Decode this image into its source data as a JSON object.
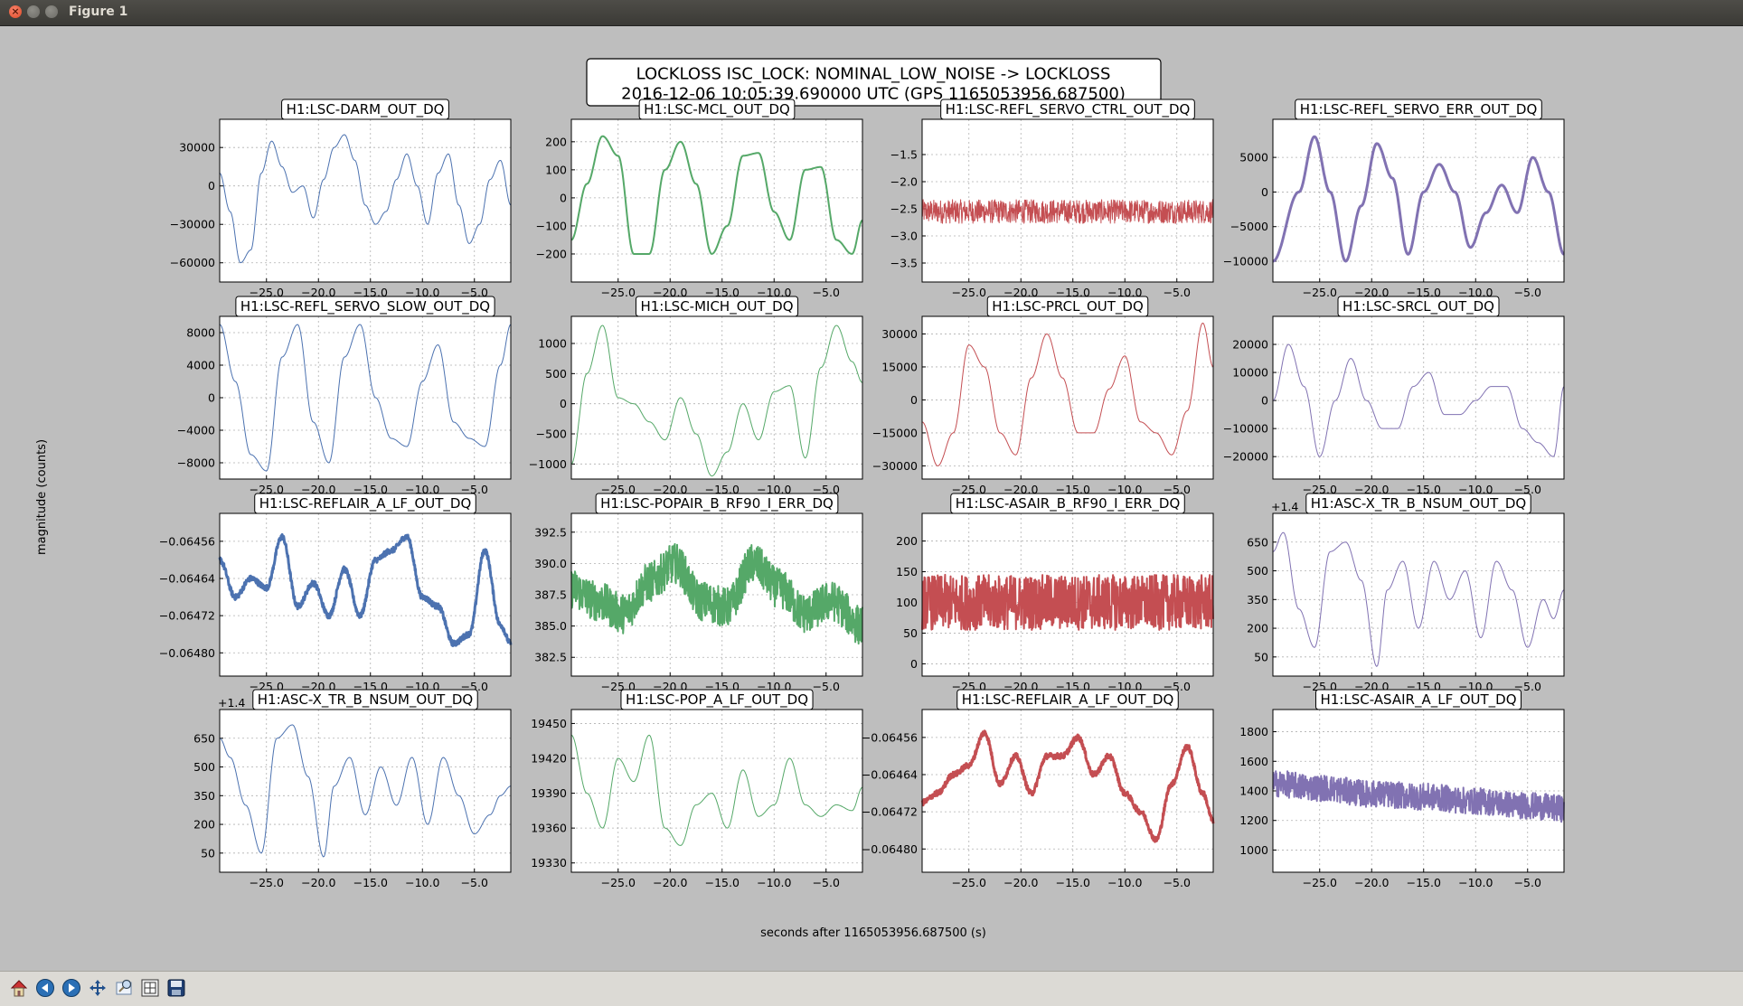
{
  "window": {
    "title": "Figure 1"
  },
  "figure": {
    "title_line1": "LOCKLOSS ISC_LOCK: NOMINAL_LOW_NOISE -> LOCKLOSS",
    "title_line2": "2016-12-06 10:05:39.690000 UTC (GPS 1165053956.687500)",
    "xlabel": "seconds after 1165053956.687500 (s)",
    "ylabel": "magnitude (counts)"
  },
  "colors": {
    "blue": "#4c72b0",
    "green": "#55a868",
    "red": "#c44e52",
    "purple": "#8172b2"
  },
  "toolbar": {
    "icons": [
      "home-icon",
      "back-icon",
      "forward-icon",
      "pan-icon",
      "zoom-icon",
      "subplots-icon",
      "save-icon"
    ]
  },
  "chart_data": [
    {
      "type": "line",
      "title": "H1:LSC-DARM_OUT_DQ",
      "color": "blue",
      "lw": 1,
      "noise": 0,
      "xlim": [
        -29.5,
        -1.5
      ],
      "ylim": [
        -75000,
        52000
      ],
      "xticks": [
        -25,
        -20,
        -15,
        -10,
        -5
      ],
      "yticks": [
        30000,
        0,
        -30000,
        -60000
      ],
      "ytick_labels": [
        "30000",
        "0",
        "−30000",
        "−60000"
      ],
      "x": [
        -29.5,
        -28.5,
        -27.5,
        -26.5,
        -25.5,
        -24.5,
        -23.5,
        -22.5,
        -21.5,
        -20.5,
        -19.5,
        -18.5,
        -17.5,
        -16.5,
        -15.5,
        -14.5,
        -13.5,
        -12.5,
        -11.5,
        -10.5,
        -9.5,
        -8.5,
        -7.5,
        -6.5,
        -5.5,
        -4.5,
        -3.5,
        -2.5,
        -1.5
      ],
      "y": [
        10000,
        -20000,
        -60000,
        -50000,
        10000,
        35000,
        15000,
        -5000,
        0,
        -25000,
        5000,
        30000,
        40000,
        20000,
        -15000,
        -30000,
        -20000,
        5000,
        25000,
        0,
        -30000,
        10000,
        25000,
        -15000,
        -45000,
        -30000,
        5000,
        20000,
        -15000
      ]
    },
    {
      "type": "line",
      "title": "H1:LSC-MCL_OUT_DQ",
      "color": "green",
      "lw": 2,
      "noise": 0,
      "xlim": [
        -29.5,
        -1.5
      ],
      "ylim": [
        -300,
        280
      ],
      "xticks": [
        -25,
        -20,
        -15,
        -10,
        -5
      ],
      "yticks": [
        200,
        100,
        0,
        -100,
        -200
      ],
      "ytick_labels": [
        "200",
        "100",
        "0",
        "−100",
        "−200"
      ],
      "x": [
        -29.5,
        -28,
        -26.5,
        -25,
        -23.5,
        -22,
        -20.5,
        -19,
        -17.5,
        -16,
        -14.5,
        -13,
        -11.5,
        -10,
        -8.5,
        -7,
        -5.5,
        -4,
        -2.5,
        -1.5
      ],
      "y": [
        -150,
        50,
        220,
        150,
        -200,
        -200,
        100,
        200,
        50,
        -200,
        -100,
        150,
        160,
        -50,
        -150,
        100,
        110,
        -150,
        -200,
        -80
      ]
    },
    {
      "type": "line",
      "title": "H1:LSC-REFL_SERVO_CTRL_OUT_DQ",
      "color": "red",
      "lw": 1,
      "noise": 0.22,
      "xlim": [
        -29.5,
        -1.5
      ],
      "ylim": [
        -3.85,
        -0.85
      ],
      "xticks": [
        -25,
        -20,
        -15,
        -10,
        -5
      ],
      "yticks": [
        -1.5,
        -2.0,
        -2.5,
        -3.0,
        -3.5
      ],
      "ytick_labels": [
        "−1.5",
        "−2.0",
        "−2.5",
        "−3.0",
        "−3.5"
      ],
      "x": [
        -29.5,
        -1.5
      ],
      "y": [
        -2.55,
        -2.55
      ]
    },
    {
      "type": "line",
      "title": "H1:LSC-REFL_SERVO_ERR_OUT_DQ",
      "color": "purple",
      "lw": 3,
      "noise": 0,
      "xlim": [
        -29.5,
        -1.5
      ],
      "ylim": [
        -13000,
        10500
      ],
      "xticks": [
        -25,
        -20,
        -15,
        -10,
        -5
      ],
      "yticks": [
        5000,
        0,
        -5000,
        -10000
      ],
      "ytick_labels": [
        "5000",
        "0",
        "−5000",
        "−10000"
      ],
      "x": [
        -29.5,
        -27,
        -25.5,
        -24,
        -22.5,
        -21,
        -19.5,
        -18,
        -16.5,
        -15,
        -13.5,
        -12,
        -10.5,
        -9,
        -7.5,
        -6,
        -4.5,
        -3,
        -1.5
      ],
      "y": [
        -10000,
        0,
        8000,
        0,
        -10000,
        -2000,
        7000,
        2000,
        -9000,
        0,
        4000,
        0,
        -8000,
        -3000,
        1000,
        -3000,
        5000,
        0,
        -9000
      ]
    },
    {
      "type": "line",
      "title": "H1:LSC-REFL_SERVO_SLOW_OUT_DQ",
      "color": "blue",
      "lw": 1,
      "noise": 0,
      "xlim": [
        -29.5,
        -1.5
      ],
      "ylim": [
        -10000,
        10000
      ],
      "xticks": [
        -25,
        -20,
        -15,
        -10,
        -5
      ],
      "yticks": [
        8000,
        4000,
        0,
        -4000,
        -8000
      ],
      "ytick_labels": [
        "8000",
        "4000",
        "0",
        "−4000",
        "−8000"
      ],
      "x": [
        -29.5,
        -28,
        -26.5,
        -25,
        -23.5,
        -22,
        -20.5,
        -19,
        -17.5,
        -16,
        -14.5,
        -13,
        -11.5,
        -10,
        -8.5,
        -7,
        -5.5,
        -4,
        -2.5,
        -1.5
      ],
      "y": [
        9000,
        2000,
        -7000,
        -9000,
        5000,
        9000,
        -3000,
        -8000,
        5000,
        9000,
        0,
        -5000,
        -6000,
        2000,
        6500,
        -3000,
        -5000,
        -6000,
        4000,
        9000
      ]
    },
    {
      "type": "line",
      "title": "H1:LSC-MICH_OUT_DQ",
      "color": "green",
      "lw": 1,
      "noise": 0,
      "xlim": [
        -29.5,
        -1.5
      ],
      "ylim": [
        -1250,
        1450
      ],
      "xticks": [
        -25,
        -20,
        -15,
        -10,
        -5
      ],
      "yticks": [
        1000,
        500,
        0,
        -500,
        -1000
      ],
      "ytick_labels": [
        "1000",
        "500",
        "0",
        "−500",
        "−1000"
      ],
      "x": [
        -29.5,
        -28,
        -26.5,
        -25,
        -23.5,
        -22,
        -20.5,
        -19,
        -17.5,
        -16,
        -14.5,
        -13,
        -11.5,
        -10,
        -8.5,
        -7,
        -5.5,
        -4,
        -2.5,
        -1.5
      ],
      "y": [
        -1000,
        500,
        1300,
        100,
        0,
        -300,
        -600,
        100,
        -500,
        -1200,
        -800,
        0,
        -600,
        200,
        300,
        -900,
        600,
        1300,
        700,
        350
      ]
    },
    {
      "type": "line",
      "title": "H1:LSC-PRCL_OUT_DQ",
      "color": "red",
      "lw": 1,
      "noise": 0,
      "xlim": [
        -29.5,
        -1.5
      ],
      "ylim": [
        -36000,
        38000
      ],
      "xticks": [
        -25,
        -20,
        -15,
        -10,
        -5
      ],
      "yticks": [
        30000,
        15000,
        0,
        -15000,
        -30000
      ],
      "ytick_labels": [
        "30000",
        "15000",
        "0",
        "−15000",
        "−30000"
      ],
      "x": [
        -29.5,
        -28,
        -26.5,
        -25,
        -23.5,
        -22,
        -20.5,
        -19,
        -17.5,
        -16,
        -14.5,
        -13,
        -11.5,
        -10,
        -8.5,
        -7,
        -5.5,
        -4,
        -2.5,
        -1.5
      ],
      "y": [
        -10000,
        -30000,
        -15000,
        25000,
        15000,
        -15000,
        -25000,
        10000,
        30000,
        10000,
        -15000,
        -15000,
        5000,
        20000,
        -10000,
        -15000,
        -25000,
        -5000,
        35000,
        15000
      ]
    },
    {
      "type": "line",
      "title": "H1:LSC-SRCL_OUT_DQ",
      "color": "purple",
      "lw": 1,
      "noise": 0,
      "xlim": [
        -29.5,
        -1.5
      ],
      "ylim": [
        -28000,
        30000
      ],
      "xticks": [
        -25,
        -20,
        -15,
        -10,
        -5
      ],
      "yticks": [
        20000,
        10000,
        0,
        -10000,
        -20000
      ],
      "ytick_labels": [
        "20000",
        "10000",
        "0",
        "−10000",
        "−20000"
      ],
      "x": [
        -29.5,
        -28,
        -26.5,
        -25,
        -23.5,
        -22,
        -20.5,
        -19,
        -17.5,
        -16,
        -14.5,
        -13,
        -11.5,
        -10,
        -8.5,
        -7,
        -5.5,
        -4,
        -2.5,
        -1.5
      ],
      "y": [
        0,
        20000,
        5000,
        -20000,
        0,
        15000,
        0,
        -10000,
        -10000,
        5000,
        10000,
        -5000,
        -5000,
        0,
        5000,
        5000,
        -10000,
        -15000,
        -20000,
        5000
      ]
    },
    {
      "type": "line",
      "title": "H1:LSC-REFLAIR_A_LF_OUT_DQ",
      "color": "blue",
      "lw": 3,
      "noise": 6e-06,
      "xlim": [
        -29.5,
        -1.5
      ],
      "ylim": [
        -0.06485,
        -0.0645
      ],
      "xticks": [
        -25,
        -20,
        -15,
        -10,
        -5
      ],
      "yticks": [
        -0.06456,
        -0.06464,
        -0.06472,
        -0.0648
      ],
      "ytick_labels": [
        "−0.06456",
        "−0.06464",
        "−0.06472",
        "−0.06480"
      ],
      "x": [
        -29.5,
        -28,
        -26.5,
        -25,
        -23.5,
        -22,
        -20.5,
        -19,
        -17.5,
        -16,
        -14.5,
        -13,
        -11.5,
        -10,
        -8.5,
        -7,
        -5.5,
        -4,
        -2.5,
        -1.5
      ],
      "y": [
        -0.0646,
        -0.06468,
        -0.06464,
        -0.06466,
        -0.06455,
        -0.0647,
        -0.06465,
        -0.06472,
        -0.06462,
        -0.06472,
        -0.0646,
        -0.06458,
        -0.06455,
        -0.06468,
        -0.0647,
        -0.06478,
        -0.06476,
        -0.06458,
        -0.06474,
        -0.06478
      ]
    },
    {
      "type": "line",
      "title": "H1:LSC-POPAIR_B_RF90_I_ERR_DQ",
      "color": "green",
      "lw": 2,
      "noise": 1.6,
      "xlim": [
        -29.5,
        -1.5
      ],
      "ylim": [
        381,
        394
      ],
      "xticks": [
        -25,
        -20,
        -15,
        -10,
        -5
      ],
      "yticks": [
        392.5,
        390,
        387.5,
        385,
        382.5
      ],
      "ytick_labels": [
        "392.5",
        "390.0",
        "387.5",
        "385.0",
        "382.5"
      ],
      "x": [
        -29.5,
        -27,
        -24.5,
        -22,
        -19.5,
        -17,
        -14.5,
        -12,
        -9.5,
        -7,
        -4.5,
        -1.5
      ],
      "y": [
        388,
        387,
        386,
        388.5,
        390,
        387,
        386.5,
        390,
        388,
        386,
        387,
        385
      ]
    },
    {
      "type": "line",
      "title": "H1:LSC-ASAIR_B_RF90_I_ERR_DQ",
      "color": "red",
      "lw": 2,
      "noise": 45,
      "xlim": [
        -29.5,
        -1.5
      ],
      "ylim": [
        -20,
        245
      ],
      "xticks": [
        -25,
        -20,
        -15,
        -10,
        -5
      ],
      "yticks": [
        200,
        150,
        100,
        50,
        0
      ],
      "ytick_labels": [
        "200",
        "150",
        "100",
        "50",
        "0"
      ],
      "x": [
        -29.5,
        -1.5
      ],
      "y": [
        100,
        100
      ]
    },
    {
      "type": "line",
      "title": "H1:ASC-X_TR_B_NSUM_OUT_DQ",
      "offset_label": "+1.4",
      "color": "purple",
      "lw": 1,
      "noise": 0,
      "xlim": [
        -29.5,
        -1.5
      ],
      "ylim": [
        -50,
        800
      ],
      "xticks": [
        -25,
        -20,
        -15,
        -10,
        -5
      ],
      "yticks": [
        650,
        500,
        350,
        200,
        50
      ],
      "ytick_labels": [
        "650",
        "500",
        "350",
        "200",
        "50"
      ],
      "x": [
        -29.5,
        -28.5,
        -27,
        -25.5,
        -24,
        -22.5,
        -21,
        -19.5,
        -18.5,
        -17,
        -15.5,
        -14,
        -12.5,
        -11,
        -9.5,
        -8,
        -6.5,
        -5,
        -3.5,
        -2.5,
        -1.5
      ],
      "y": [
        600,
        700,
        300,
        100,
        600,
        650,
        450,
        0,
        400,
        550,
        200,
        550,
        350,
        500,
        150,
        550,
        400,
        100,
        350,
        250,
        400
      ]
    },
    {
      "type": "line",
      "title": "H1:ASC-X_TR_B_NSUM_OUT_DQ",
      "offset_label": "+1.4",
      "color": "blue",
      "lw": 1,
      "noise": 0,
      "xlim": [
        -29.5,
        -1.5
      ],
      "ylim": [
        -50,
        800
      ],
      "xticks": [
        -25,
        -20,
        -15,
        -10,
        -5
      ],
      "yticks": [
        650,
        500,
        350,
        200,
        50
      ],
      "ytick_labels": [
        "650",
        "500",
        "350",
        "200",
        "50"
      ],
      "x": [
        -29.5,
        -28.5,
        -27,
        -25.5,
        -24,
        -22.5,
        -21,
        -19.5,
        -18.5,
        -17,
        -15.5,
        -14,
        -12.5,
        -11,
        -9.5,
        -8,
        -6.5,
        -5,
        -3.5,
        -2.5,
        -1.5
      ],
      "y": [
        650,
        550,
        300,
        50,
        650,
        720,
        450,
        30,
        400,
        550,
        250,
        500,
        300,
        550,
        200,
        550,
        350,
        150,
        250,
        350,
        400
      ]
    },
    {
      "type": "line",
      "title": "H1:LSC-POP_A_LF_OUT_DQ",
      "color": "green",
      "lw": 1,
      "noise": 0,
      "xlim": [
        -29.5,
        -1.5
      ],
      "ylim": [
        19322,
        19462
      ],
      "xticks": [
        -25,
        -20,
        -15,
        -10,
        -5
      ],
      "yticks": [
        19450,
        19420,
        19390,
        19360,
        19330
      ],
      "ytick_labels": [
        "19450",
        "19420",
        "19390",
        "19360",
        "19330"
      ],
      "x": [
        -29.5,
        -28,
        -26.5,
        -25,
        -23.5,
        -22,
        -20.5,
        -19,
        -17.5,
        -16,
        -14.5,
        -13,
        -11.5,
        -10,
        -8.5,
        -7,
        -5.5,
        -4,
        -2.5,
        -1.5
      ],
      "y": [
        19440,
        19390,
        19360,
        19420,
        19400,
        19440,
        19360,
        19345,
        19380,
        19390,
        19360,
        19410,
        19370,
        19380,
        19420,
        19380,
        19370,
        19380,
        19375,
        19395
      ]
    },
    {
      "type": "line",
      "title": "H1:LSC-REFLAIR_A_LF_OUT_DQ",
      "color": "red",
      "lw": 3,
      "noise": 6e-06,
      "xlim": [
        -29.5,
        -1.5
      ],
      "ylim": [
        -0.06485,
        -0.0645
      ],
      "xticks": [
        -25,
        -20,
        -15,
        -10,
        -5
      ],
      "yticks": [
        -0.06456,
        -0.06464,
        -0.06472,
        -0.0648
      ],
      "ytick_labels": [
        "−0.06456",
        "−0.06464",
        "−0.06472",
        "−0.06480"
      ],
      "x": [
        -29.5,
        -28,
        -26.5,
        -25,
        -23.5,
        -22,
        -20.5,
        -19,
        -17.5,
        -16,
        -14.5,
        -13,
        -11.5,
        -10,
        -8.5,
        -7,
        -5.5,
        -4,
        -2.5,
        -1.5
      ],
      "y": [
        -0.0647,
        -0.06468,
        -0.06464,
        -0.06462,
        -0.06455,
        -0.06466,
        -0.0646,
        -0.06468,
        -0.0646,
        -0.0646,
        -0.06456,
        -0.06464,
        -0.0646,
        -0.06468,
        -0.06472,
        -0.06478,
        -0.06466,
        -0.06458,
        -0.06468,
        -0.06474
      ]
    },
    {
      "type": "line",
      "title": "H1:LSC-ASAIR_A_LF_OUT_DQ",
      "color": "purple",
      "lw": 2,
      "noise": 90,
      "xlim": [
        -29.5,
        -1.5
      ],
      "ylim": [
        850,
        1950
      ],
      "xticks": [
        -25,
        -20,
        -15,
        -10,
        -5
      ],
      "yticks": [
        1800,
        1600,
        1400,
        1200,
        1000
      ],
      "ytick_labels": [
        "1800",
        "1600",
        "1400",
        "1200",
        "1000"
      ],
      "x": [
        -29.5,
        -25,
        -20,
        -15,
        -10,
        -5,
        -1.5
      ],
      "y": [
        1450,
        1420,
        1380,
        1360,
        1330,
        1300,
        1280
      ]
    }
  ]
}
